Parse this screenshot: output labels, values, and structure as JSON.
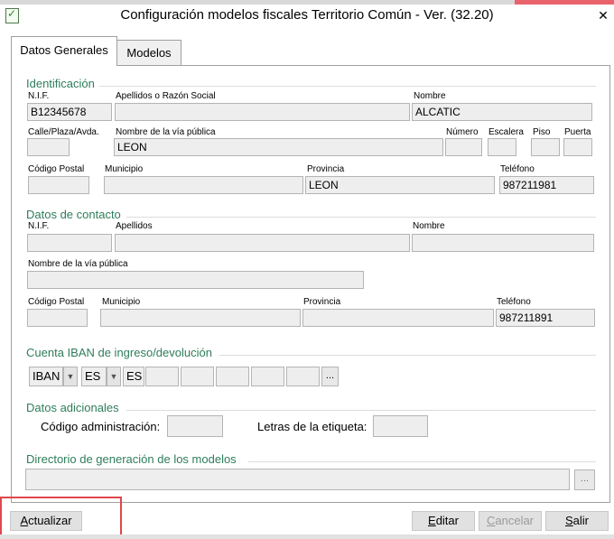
{
  "window": {
    "title": "Configuración modelos fiscales Territorio Común - Ver. (32.20)",
    "close": "✕"
  },
  "tabs": [
    {
      "label": "Datos Generales"
    },
    {
      "label": "Modelos"
    }
  ],
  "identificacion": {
    "section": "Identificación",
    "nif_label": "N.I.F.",
    "nif": "B12345678",
    "apellidos_label": "Apellidos o Razón Social",
    "apellidos": "",
    "nombre_label": "Nombre",
    "nombre": "ALCATIC",
    "calle_label": "Calle/Plaza/Avda.",
    "calle": "",
    "via_label": "Nombre de la vía pública",
    "via": "LEON",
    "numero_label": "Número",
    "escalera_label": "Escalera",
    "piso_label": "Piso",
    "puerta_label": "Puerta",
    "cp_label": "Código Postal",
    "municipio_label": "Municipio",
    "provincia_label": "Provincia",
    "provincia": "LEON",
    "telefono_label": "Teléfono",
    "telefono": "987211981"
  },
  "contacto": {
    "section": "Datos de contacto",
    "nif_label": "N.I.F.",
    "apellidos_label": "Apellidos",
    "nombre_label": "Nombre",
    "via_label": "Nombre de la vía pública",
    "cp_label": "Código Postal",
    "municipio_label": "Municipio",
    "provincia_label": "Provincia",
    "telefono_label": "Teléfono",
    "telefono": "987211891"
  },
  "iban": {
    "section": "Cuenta IBAN de ingreso/devolución",
    "prefix": "IBAN",
    "country": "ES",
    "country2": "ES",
    "more": "..."
  },
  "adicionales": {
    "section": "Datos adicionales",
    "codigo_label": "Código administración:",
    "letras_label": "Letras de la etiqueta:"
  },
  "directorio": {
    "section": "Directorio de generación de los modelos",
    "path": "",
    "browse": "..."
  },
  "buttons": {
    "actualizar": {
      "first": "A",
      "rest": "ctualizar"
    },
    "editar": {
      "first": "E",
      "rest": "ditar"
    },
    "cancelar": {
      "first": "C",
      "rest": "ancelar"
    },
    "salir": {
      "first": "S",
      "rest": "alir"
    }
  },
  "arrow": "▼"
}
